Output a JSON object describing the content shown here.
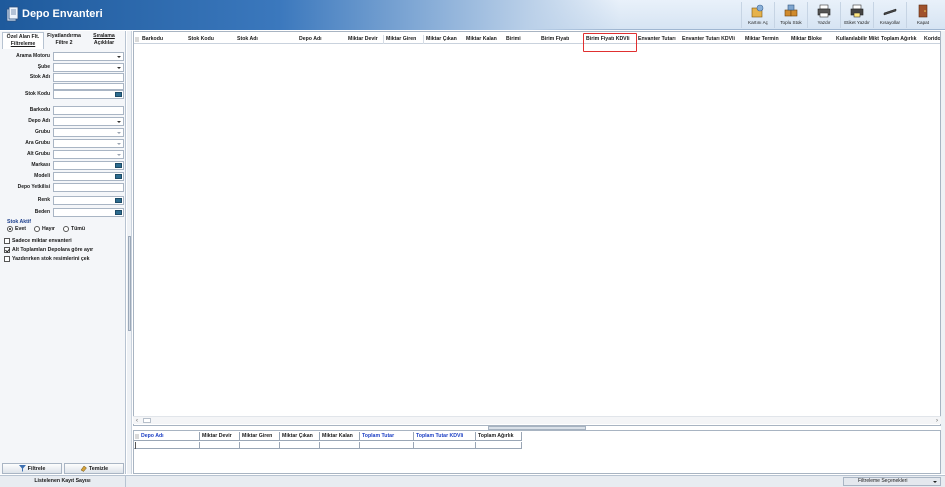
{
  "window": {
    "title": "Depo Envanteri"
  },
  "toolbar": {
    "buttons": [
      {
        "label": "Kartını Aç",
        "icon": "open-card-icon"
      },
      {
        "label": "Toplu Stok",
        "icon": "bulk-stock-icon"
      },
      {
        "label": "Yazdır",
        "icon": "printer-icon"
      },
      {
        "label": "Etiket Yazdır",
        "icon": "label-printer-icon"
      },
      {
        "label": "Kısayollar",
        "icon": "shortcuts-icon"
      },
      {
        "label": "Kapat",
        "icon": "exit-door-icon"
      }
    ]
  },
  "left_panel": {
    "tabs": [
      {
        "line1": "Özel Alan Flt.",
        "line2": "Filtreleme"
      },
      {
        "line1": "Fiyatlandırma",
        "line2": "Filtre 2"
      },
      {
        "line1": "Sıralama",
        "line2": "Açıklılar"
      }
    ],
    "filters": [
      {
        "label": "Arama Motoru",
        "kind": "dropdown",
        "value": ""
      },
      {
        "label": "Şube",
        "kind": "dropdown",
        "value": ""
      },
      {
        "label": "Stok Adı",
        "kind": "text",
        "value": ""
      },
      {
        "label": "Stok Kodu",
        "kind": "lookup",
        "value": ""
      },
      {
        "label": "Barkodu",
        "kind": "text",
        "value": ""
      },
      {
        "label": "Depo Adı",
        "kind": "dropdown",
        "value": ""
      },
      {
        "label": "Grubu",
        "kind": "dropdown-disabled",
        "value": ""
      },
      {
        "label": "Ara Grubu",
        "kind": "dropdown-disabled",
        "value": ""
      },
      {
        "label": "Alt Grubu",
        "kind": "dropdown-disabled",
        "value": ""
      },
      {
        "label": "Markası",
        "kind": "lookup",
        "value": ""
      },
      {
        "label": "Modeli",
        "kind": "lookup",
        "value": ""
      },
      {
        "label": "Depo Yetkilisi",
        "kind": "text",
        "value": ""
      },
      {
        "label": "Renk",
        "kind": "lookup",
        "value": ""
      },
      {
        "label": "Beden",
        "kind": "lookup",
        "value": ""
      }
    ],
    "stok_aktif": {
      "label": "Stok Aktif",
      "options": [
        {
          "label": "Evet",
          "selected": true
        },
        {
          "label": "Hayır",
          "selected": false
        },
        {
          "label": "Tümü",
          "selected": false
        }
      ]
    },
    "checkboxes": [
      {
        "label": "Sadece miktar envanteri",
        "checked": false
      },
      {
        "label": "Alt Toplamları Depolara göre ayır",
        "checked": true
      },
      {
        "label": "Yazdırırken stok resimlerini çek",
        "checked": false
      }
    ],
    "buttons": {
      "filter": "Filtrele",
      "clear": "Temizle"
    }
  },
  "main_grid": {
    "columns": [
      "Barkodu",
      "Stok Kodu",
      "Stok Adı",
      "Depo Adı",
      "Miktar Devir",
      "Miktar Giren",
      "Miktar Çıkan",
      "Miktar Kalan",
      "Birimi",
      "Birim Fiyatı",
      "Birim Fiyatı KDVli",
      "Envanter Tutarı",
      "Envanter Tutarı KDVli",
      "Miktar Termin",
      "Miktar Bloke",
      "Kullanılabilir Miktar",
      "Toplam Ağırlık",
      "Koridor"
    ],
    "highlighted_column": "Birim Fiyatı KDVli",
    "rows": []
  },
  "summary_grid": {
    "columns": [
      {
        "label": "Depo Adı",
        "blue": true
      },
      {
        "label": "Miktar Devir",
        "blue": false
      },
      {
        "label": "Miktar Giren",
        "blue": false
      },
      {
        "label": "Miktar Çıkan",
        "blue": false
      },
      {
        "label": "Miktar Kalan",
        "blue": false
      },
      {
        "label": "Toplam Tutar",
        "blue": true
      },
      {
        "label": "Toplam Tutar KDVli",
        "blue": true
      },
      {
        "label": "Toplam Ağırlık",
        "blue": false
      }
    ]
  },
  "status": {
    "record_count_label": "Listelenen Kayıt Sayısı",
    "filter_options_label": "Filtreleme Seçenekleri"
  },
  "colors": {
    "highlight_border": "#e03030",
    "summary_blue": "#1c3fc4",
    "title_band": "#1e5a9c"
  }
}
